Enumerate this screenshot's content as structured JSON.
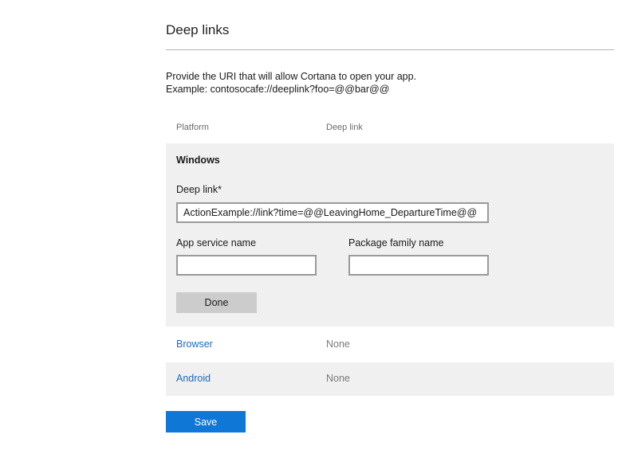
{
  "section": {
    "title": "Deep links",
    "description_line1": "Provide the URI that will allow Cortana to open your app.",
    "description_line2": "Example: contosocafe://deeplink?foo=@@bar@@"
  },
  "table": {
    "headers": {
      "platform": "Platform",
      "deep_link": "Deep link"
    }
  },
  "windows": {
    "title": "Windows",
    "deep_link_label": "Deep link*",
    "deep_link_value": "ActionExample://link?time=@@LeavingHome_DepartureTime@@",
    "app_service_label": "App service name",
    "app_service_value": "",
    "package_family_label": "Package family name",
    "package_family_value": "",
    "done_label": "Done"
  },
  "platforms": [
    {
      "name": "Browser",
      "value": "None"
    },
    {
      "name": "Android",
      "value": "None"
    }
  ],
  "save_label": "Save",
  "colors": {
    "accent": "#0f78d7",
    "link": "#1a6bb8",
    "panel_background": "#f0f0f0"
  }
}
